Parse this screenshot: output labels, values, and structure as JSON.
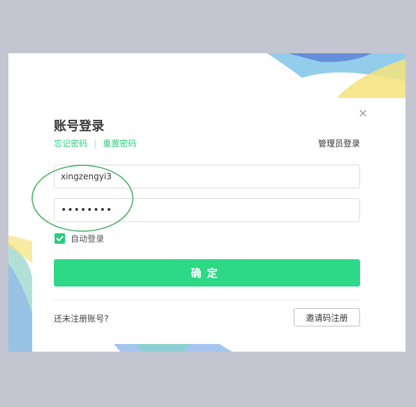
{
  "login": {
    "title": "账号登录",
    "forgot_password": "忘记密码",
    "separator": "|",
    "reset_password": "重置密码",
    "admin_login": "管理员登录",
    "username_value": "xingzengyi3",
    "password_value": "••••••••",
    "auto_login_label": "自动登录",
    "auto_login_checked": true,
    "confirm_button": "确定",
    "no_account_text": "还未注册账号?",
    "invite_register_button": "邀请码注册",
    "close_symbol": "×"
  },
  "colors": {
    "accent": "#2dd886",
    "link": "#2bcc7f",
    "background": "#c3c6d0",
    "highlight_circle": "#3fae5c"
  },
  "icons": [
    "close-icon",
    "checkmark-icon"
  ]
}
